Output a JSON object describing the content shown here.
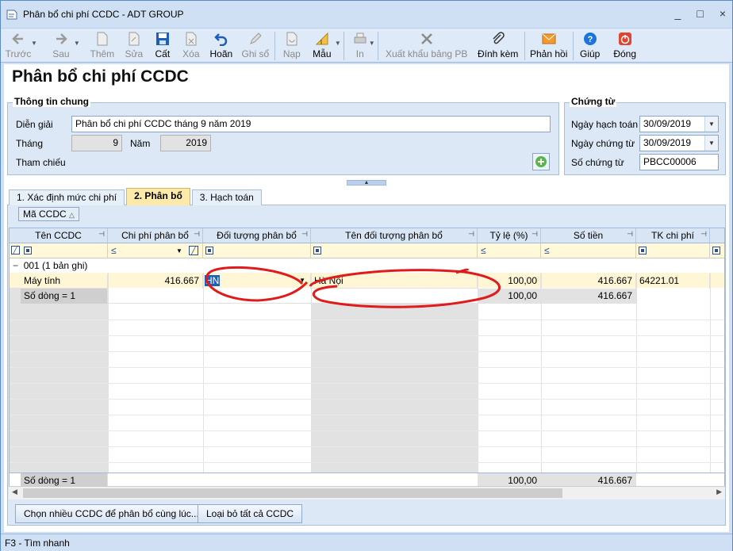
{
  "window": {
    "title": "Phân bổ chi phí CCDC - ADT GROUP",
    "controls": [
      "_",
      "□",
      "×"
    ]
  },
  "toolbar": {
    "items": [
      {
        "label": "Trước",
        "icon": "arrow-left-icon",
        "enabled": false
      },
      {
        "label": "Sau",
        "icon": "arrow-right-icon",
        "enabled": false
      },
      {
        "label": "Thêm",
        "icon": "add-doc-icon",
        "enabled": false
      },
      {
        "label": "Sửa",
        "icon": "edit-doc-icon",
        "enabled": false
      },
      {
        "label": "Cất",
        "icon": "save-icon",
        "enabled": true
      },
      {
        "label": "Xóa",
        "icon": "delete-doc-icon",
        "enabled": false
      },
      {
        "label": "Hoãn",
        "icon": "undo-icon",
        "enabled": true
      },
      {
        "label": "Ghi sổ",
        "icon": "pencil-icon",
        "enabled": false
      },
      {
        "label": "Nạp",
        "icon": "reload-icon",
        "enabled": false
      },
      {
        "label": "Mẫu",
        "icon": "template-icon",
        "enabled": true
      },
      {
        "label": "In",
        "icon": "print-icon",
        "enabled": false
      },
      {
        "label": "Xuất khẩu bảng PB",
        "icon": "excel-icon",
        "enabled": false
      },
      {
        "label": "Đính kèm",
        "icon": "attach-icon",
        "enabled": true
      },
      {
        "label": "Phản hồi",
        "icon": "mail-icon",
        "enabled": true
      },
      {
        "label": "Giúp",
        "icon": "help-icon",
        "enabled": true
      },
      {
        "label": "Đóng",
        "icon": "close-icon",
        "enabled": true
      }
    ]
  },
  "page_title": "Phân bổ chi phí CCDC",
  "general": {
    "legend": "Thông tin chung",
    "dien_giai_label": "Diễn giải",
    "dien_giai_value": "Phân bổ chi phí CCDC tháng 9 năm 2019",
    "thang_label": "Tháng",
    "thang_value": "9",
    "nam_label": "Năm",
    "nam_value": "2019",
    "tham_chieu_label": "Tham chiếu"
  },
  "voucher": {
    "legend": "Chứng từ",
    "ngay_hach_toan_label": "Ngày hạch toán",
    "ngay_hach_toan_value": "30/09/2019",
    "ngay_chung_tu_label": "Ngày chứng từ",
    "ngay_chung_tu_value": "30/09/2019",
    "so_chung_tu_label": "Số chứng từ",
    "so_chung_tu_value": "PBCC00006"
  },
  "tabs": [
    {
      "label": "1. Xác định mức chi phí",
      "active": false
    },
    {
      "label": "2. Phân bổ",
      "active": true
    },
    {
      "label": "3. Hạch toán",
      "active": false
    }
  ],
  "group_chip": "Mã CCDC",
  "grid": {
    "columns": [
      "Tên CCDC",
      "Chi phí phân bổ",
      "Đối tượng phân bổ",
      "Tên đối tượng phân bổ",
      "Tỷ lệ (%)",
      "Số tiền",
      "TK chi phí"
    ],
    "filter_ops": [
      "",
      "≤",
      "",
      "",
      "≤",
      "≤",
      ""
    ],
    "group_label": "001 (1 bản ghi)",
    "rows": [
      {
        "ten_ccdc": "Máy tính",
        "chi_phi": "416.667",
        "doi_tuong": "HN",
        "ten_doi_tuong": "Hà Nội",
        "ty_le": "100,00",
        "so_tien": "416.667",
        "tk_chi_phi": "64221.01"
      }
    ],
    "group_footer": {
      "label": "Số dòng = 1",
      "ty_le": "100,00",
      "so_tien": "416.667"
    },
    "footer": {
      "label": "Số dòng = 1",
      "ty_le": "100,00",
      "so_tien": "416.667"
    }
  },
  "buttons": {
    "select_many": "Chọn nhiều CCDC để phân bổ cùng lúc...",
    "remove_all": "Loại bỏ tất cả CCDC"
  },
  "status": "F3 - Tìm nhanh",
  "colors": {
    "accent": "#1c5fb8",
    "annotation": "#e01b1b",
    "active_tab": "#fde9a8",
    "filter_row": "#fff9d9",
    "selected_row": "#fff6d5"
  }
}
